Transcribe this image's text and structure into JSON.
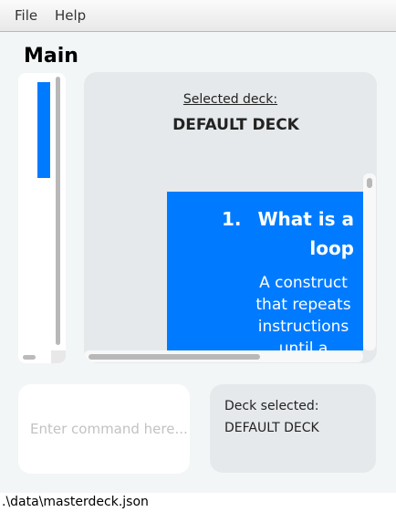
{
  "menu": {
    "file": "File",
    "help": "Help"
  },
  "title": "Main",
  "deck_panel": {
    "label": "Selected deck:",
    "deck_name": "DEFAULT DECK"
  },
  "card": {
    "index": "1.",
    "question": "What is a loop",
    "answer": "A construct that repeats instructions until a"
  },
  "command": {
    "placeholder": "Enter command here...",
    "value": ""
  },
  "result": {
    "line1": "Deck selected:",
    "line2": "DEFAULT DECK"
  },
  "status": {
    "path": ".\\data\\masterdeck.json"
  },
  "colors": {
    "accent": "#007bff",
    "panel": "#e6e9eb"
  }
}
